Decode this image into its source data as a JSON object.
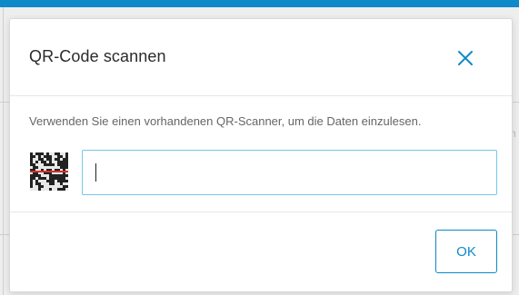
{
  "dialog": {
    "title": "QR-Code scannen",
    "close_icon": "close-icon",
    "description": "Verwenden Sie einen vorhandenen QR-Scanner, um die Daten einzulesen.",
    "qr_icon": "qr-code-icon",
    "input": {
      "value": "",
      "placeholder": ""
    },
    "ok_label": "OK"
  },
  "colors": {
    "accent": "#0e89c9",
    "input_focus_border": "#74c7ed",
    "title_text": "#2b2b2b",
    "body_text": "#666666"
  }
}
